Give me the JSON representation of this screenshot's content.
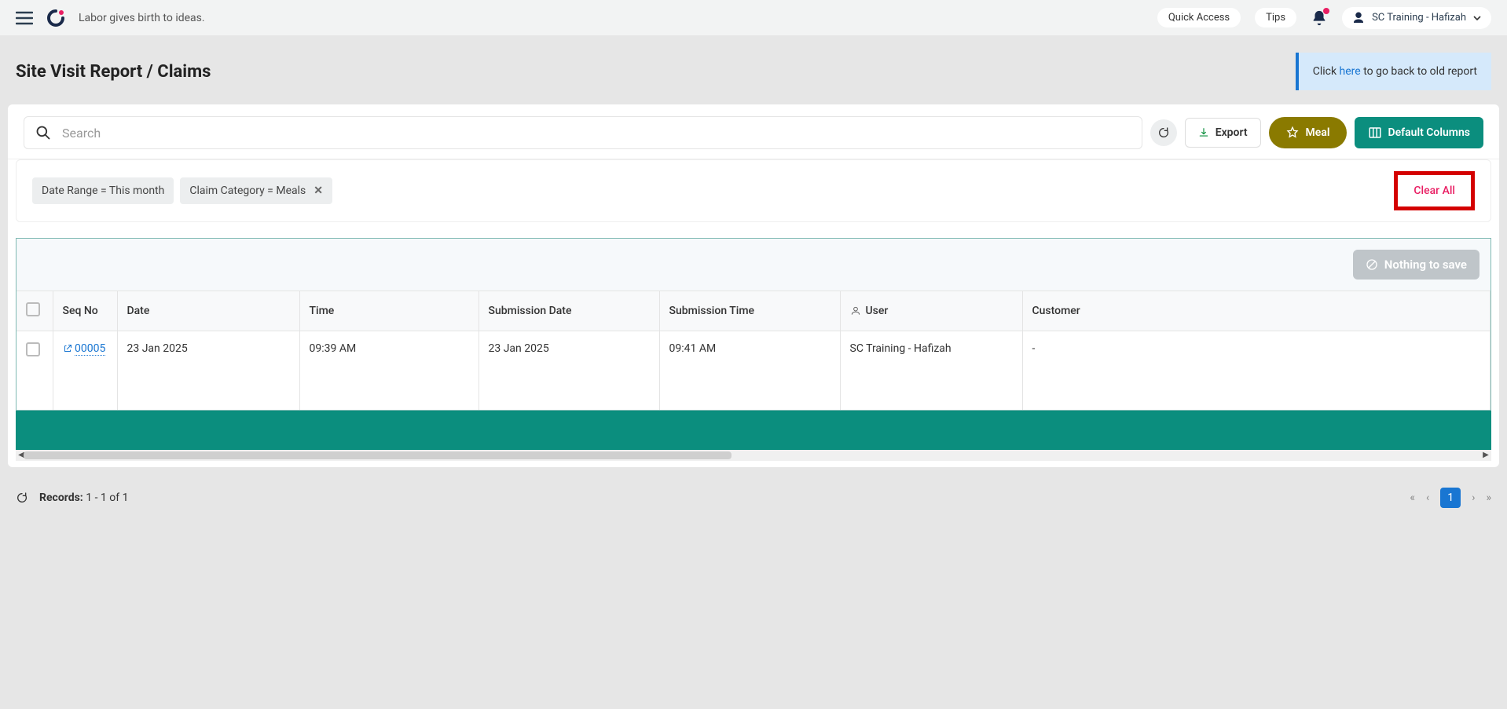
{
  "topbar": {
    "tagline": "Labor gives birth to ideas.",
    "quick_access": "Quick Access",
    "tips": "Tips",
    "user_name": "SC Training - Hafizah"
  },
  "page": {
    "title": "Site Visit Report / Claims",
    "old_report_prefix": "Click ",
    "old_report_link": "here",
    "old_report_suffix": " to go back to old report"
  },
  "toolbar": {
    "search_placeholder": "Search",
    "export": "Export",
    "meal": "Meal",
    "default_columns": "Default Columns"
  },
  "filters": {
    "date_range": "Date Range  =  This month",
    "claim_category": "Claim Category  =  Meals",
    "clear_all": "Clear All"
  },
  "table": {
    "nothing_to_save": "Nothing to save",
    "headers": {
      "seq": "Seq No",
      "date": "Date",
      "time": "Time",
      "sub_date": "Submission Date",
      "sub_time": "Submission Time",
      "user": "User",
      "customer": "Customer"
    },
    "rows": [
      {
        "seq": "00005",
        "date": "23 Jan 2025",
        "time": "09:39 AM",
        "sub_date": "23 Jan 2025",
        "sub_time": "09:41 AM",
        "user": "SC Training - Hafizah",
        "customer": "-"
      }
    ]
  },
  "footer": {
    "records_label": "Records:",
    "records_value": "1 - 1   of   1",
    "page_current": "1"
  }
}
